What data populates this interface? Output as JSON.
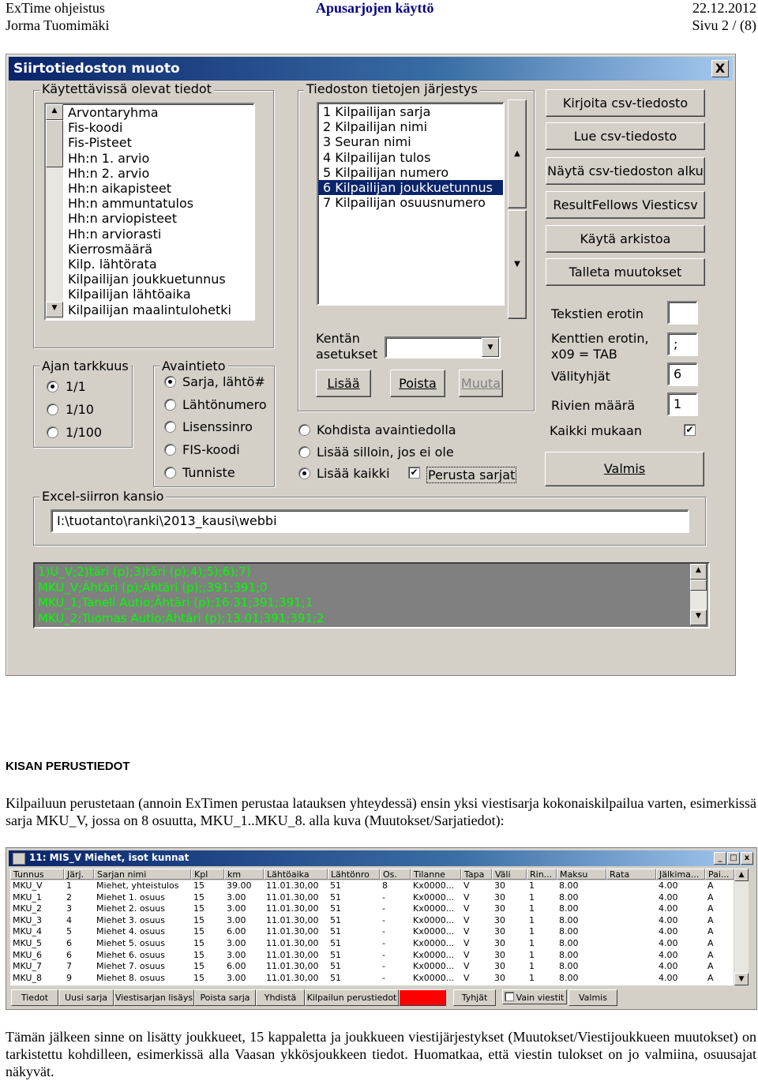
{
  "header": {
    "left1": "ExTime ohjeistus",
    "center1": "Apusarjojen käyttö",
    "right1": "22.12.2012",
    "left2": "Jorma Tuomimäki",
    "right2": "Sivu 2 / (8)"
  },
  "dialog1": {
    "title": "Siirtotiedoston muoto",
    "close": "X",
    "available_group": "Käytettävissä olevat tiedot",
    "available_items": [
      "Arvontaryhma",
      "Fis-koodi",
      "Fis-Pisteet",
      "Hh:n 1. arvio",
      "Hh:n 2. arvio",
      "Hh:n aikapisteet",
      "Hh:n ammuntatulos",
      "Hh:n arviopisteet",
      "Hh:n arviorasti",
      "Kierrosmäärä",
      "Kilp. lähtörata",
      "Kilpailijan joukkuetunnus",
      "Kilpailijan lähtöaika",
      "Kilpailijan maalintulohetki"
    ],
    "order_group": "Tiedoston tietojen järjestys",
    "order_items": [
      "1 Kilpailijan sarja",
      "2 Kilpailijan nimi",
      "3 Seuran nimi",
      "4 Kilpailijan tulos",
      "5 Kilpailijan numero",
      "6 Kilpailijan joukkuetunnus",
      "7 Kilpailijan osuusnumero"
    ],
    "order_selected": 5,
    "field_settings_label1": "Kentän",
    "field_settings_label2": "asetukset",
    "field_settings_value": "",
    "btn_add": "Lisää",
    "btn_remove": "Poista",
    "btn_change": "Muuta",
    "buttons": [
      "Kirjoita csv-tiedosto",
      "Lue csv-tiedosto",
      "Näytä csv-tiedoston alku",
      "ResultFellows Viesticsv",
      "Käytä arkistoa",
      "Talleta muutokset"
    ],
    "text_sep_label": "Tekstien erotin",
    "text_sep_value": "",
    "field_sep_label1": "Kenttien erotin,",
    "field_sep_label2": "x09 = TAB",
    "field_sep_value": ";",
    "spaces_label": "Välityhjät",
    "spaces_value": "6",
    "rows_label": "Rivien määrä",
    "rows_value": "1",
    "include_all_label": "Kaikki mukaan",
    "include_all_checked": "✔",
    "done_button": "Valmis",
    "time_group": "Ajan tarkkuus",
    "time_options": [
      "1/1",
      "1/10",
      "1/100"
    ],
    "key_group": "Avaintieto",
    "key_options": [
      "Sarja, lähtö#",
      "Lähtönumero",
      "Lisenssinro",
      "FIS-koodi",
      "Tunniste"
    ],
    "match_options": [
      "Kohdista avaintiedolla",
      "Lisää silloin, jos ei ole",
      "Lisää kaikki"
    ],
    "create_classes_label": "Perusta sarjat",
    "create_classes_checked": "✔",
    "excel_group": "Excel-siirron kansio",
    "excel_path": "I:\\tuotanto\\ranki\\2013_kausi\\webbi",
    "console_lines": [
      "1)U_V;2)täri (p);3)täri (p);4);5);6);7)",
      "MKU_V;Ähtäri (p);Ähtäri (p);;391;391;0",
      "MKU_1;Taneli Autio;Ähtäri (p);16.31;391;391;1",
      "MKU_2;Tuomas Autio;Ähtäri (p);13.01;391;391;2"
    ]
  },
  "section": {
    "heading": "KISAN PERUSTIEDOT",
    "para1": "Kilpailuun perustetaan (annoin ExTimen perustaa latauksen yhteydessä) ensin yksi viestisarja kokonaiskilpailua varten, esimerkissä sarja MKU_V, jossa on 8 osuutta, MKU_1..MKU_8. alla kuva (Muutokset/Sarjatiedot):",
    "para2": "Tämän jälkeen sinne on lisätty joukkueet, 15 kappaletta ja joukkueen viestijärjestykset (Muutokset/Viestijoukkueen muutokset) on tarkistettu kohdilleen, esimerkissä alla Vaasan ykkösjoukkeen tiedot. Huomatkaa, että viestin tulokset on jo valmiina, osuusajat näkyvät."
  },
  "dialog2": {
    "title": "11: MIS_V  Miehet, isot kunnat",
    "columns": [
      "Tunnus",
      "Järj.",
      "Sarjan nimi",
      "Kpl",
      "km",
      "Lähtöaika",
      "Lähtönro",
      "Os.",
      "Tilanne",
      "Tapa",
      "Väli",
      "Rin...",
      "Maksu",
      "Rata",
      "Jälkima...",
      "Pai..."
    ],
    "rows": [
      [
        "MKU_V",
        "1",
        "Miehet, yhteistulos",
        "15",
        "39.00",
        "11.01.30,00",
        "51",
        "8",
        "Kx0000...",
        "V",
        "30",
        "1",
        "8.00",
        "",
        "4.00",
        "A"
      ],
      [
        "MKU_1",
        "2",
        "Miehet 1. osuus",
        "15",
        "3.00",
        "11.01.30,00",
        "51",
        "-",
        "Kx0000...",
        "V",
        "30",
        "1",
        "8.00",
        "",
        "4.00",
        "A"
      ],
      [
        "MKU_2",
        "3",
        "Miehet 2. osuus",
        "15",
        "3.00",
        "11.01.30,00",
        "51",
        "-",
        "Kx0000...",
        "V",
        "30",
        "1",
        "8.00",
        "",
        "4.00",
        "A"
      ],
      [
        "MKU_3",
        "4",
        "Miehet 3. osuus",
        "15",
        "3.00",
        "11.01.30,00",
        "51",
        "-",
        "Kx0000...",
        "V",
        "30",
        "1",
        "8.00",
        "",
        "4.00",
        "A"
      ],
      [
        "MKU_4",
        "5",
        "Miehet 4. osuus",
        "15",
        "6.00",
        "11.01.30,00",
        "51",
        "-",
        "Kx0000...",
        "V",
        "30",
        "1",
        "8.00",
        "",
        "4.00",
        "A"
      ],
      [
        "MKU_5",
        "6",
        "Miehet 5. osuus",
        "15",
        "3.00",
        "11.01.30,00",
        "51",
        "-",
        "Kx0000...",
        "V",
        "30",
        "1",
        "8.00",
        "",
        "4.00",
        "A"
      ],
      [
        "MKU_6",
        "6",
        "Miehet 6. osuus",
        "15",
        "3.00",
        "11.01.30,00",
        "51",
        "-",
        "Kx0000...",
        "V",
        "30",
        "1",
        "8.00",
        "",
        "4.00",
        "A"
      ],
      [
        "MKU_7",
        "7",
        "Miehet 7. osuus",
        "15",
        "6.00",
        "11.01.30,00",
        "51",
        "-",
        "Kx0000...",
        "V",
        "30",
        "1",
        "8.00",
        "",
        "4.00",
        "A"
      ],
      [
        "MKU_8",
        "9",
        "Miehet 8. osuus",
        "15",
        "3.00",
        "11.01.30,00",
        "51",
        "-",
        "Kx0000...",
        "V",
        "30",
        "1",
        "8.00",
        "",
        "4.00",
        "A"
      ]
    ],
    "bottom_buttons": [
      "Tiedot",
      "Uusi sarja",
      "Viestisarjan lisäys",
      "Poista sarja",
      "Yhdistä",
      "Kilpailun perustiedot",
      "",
      "Tyhjät",
      "Vain viestit",
      "Valmis"
    ]
  }
}
